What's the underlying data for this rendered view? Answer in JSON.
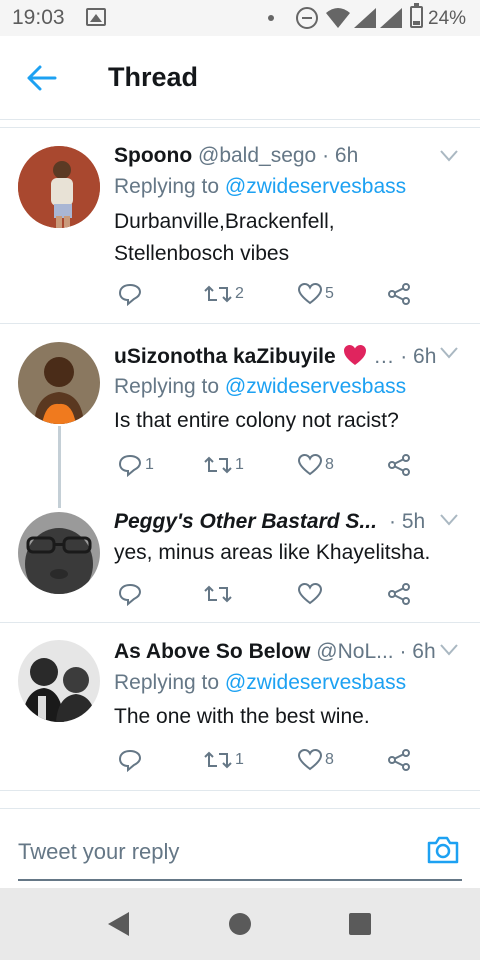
{
  "status_bar": {
    "time": "19:03",
    "battery": "24%"
  },
  "header": {
    "title": "Thread",
    "back_icon": "arrow-left-icon"
  },
  "tweets": [
    {
      "name": "Spoono",
      "handle": "@bald_sego",
      "time": "· 6h",
      "replying_label": "Replying to",
      "replying_to": "@zwideservesbass",
      "text_lines": [
        "Durbanville,Brackenfell,",
        "Stellenbosch vibes"
      ],
      "retweets": "2",
      "likes": "5",
      "avatar_color": "#b5533a"
    },
    {
      "name": "uSizonotha kaZibuyile",
      "name_suffix": "…",
      "time": "· 6h",
      "replying_label": "Replying to",
      "replying_to": "@zwideservesbass",
      "text_lines": [
        "Is that entire colony not racist?"
      ],
      "replies": "1",
      "retweets": "1",
      "likes": "8",
      "avatar_color": "#6b4a2a"
    },
    {
      "name": "Peggy's Other Bastard S...",
      "time": "· 5h",
      "text_lines": [
        "yes, minus areas like Khayelitsha."
      ],
      "avatar_color": "#3a3a3a"
    },
    {
      "name": "As Above So Below",
      "handle": "@NoL...",
      "time": "· 6h",
      "replying_label": "Replying to",
      "replying_to": "@zwideservesbass",
      "text_lines": [
        "The one with the best wine."
      ],
      "retweets": "1",
      "likes": "8",
      "avatar_color": "#2b2b2b"
    }
  ],
  "composer": {
    "placeholder": "Tweet your reply"
  },
  "colors": {
    "accent": "#1da1f2",
    "muted": "#657786",
    "heart": "#e0245e"
  }
}
